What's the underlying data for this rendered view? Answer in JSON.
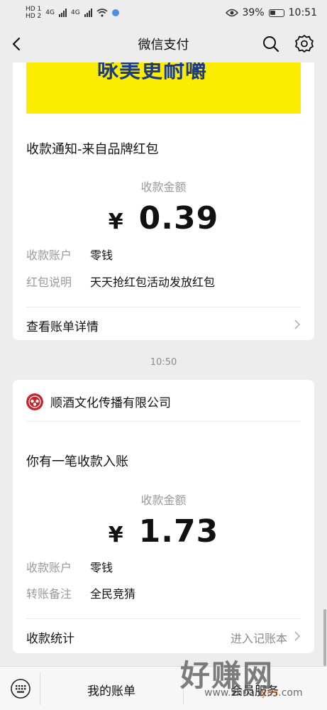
{
  "status_bar": {
    "hd1": "HD 1",
    "hd2": "HD 2",
    "net1": "4G",
    "net2": "4G",
    "battery": "39%",
    "time": "10:51"
  },
  "header": {
    "title": "微信支付"
  },
  "card1": {
    "banner_text": "咏美更耐嚼",
    "title": "收款通知-来自品牌红包",
    "amount_label": "收款金额",
    "currency": "¥",
    "amount": "0.39",
    "fields": [
      {
        "label": "收款账户",
        "value": "零钱"
      },
      {
        "label": "红包说明",
        "value": "天天抢红包活动发放红包"
      }
    ],
    "link": "查看账单详情"
  },
  "time_separator": "10:50",
  "card2": {
    "merchant_name": "顺酒文化传播有限公司",
    "title": "你有一笔收款入账",
    "amount_label": "收款金额",
    "currency": "¥",
    "amount": "1.73",
    "fields": [
      {
        "label": "收款账户",
        "value": "零钱"
      },
      {
        "label": "转账备注",
        "value": "全民竞猜"
      }
    ],
    "link": "收款统计",
    "link_hint": "进入记账本"
  },
  "bottom_bar": {
    "items": [
      "我的账单",
      "会员服务"
    ]
  },
  "watermark": {
    "main": "好赚网",
    "sub_a": "www.zhuan",
    "sub_b": "yes",
    "sub_c": ".com"
  },
  "colors": {
    "banner": "#fbed00",
    "merchant_logo": "#c8222c"
  }
}
